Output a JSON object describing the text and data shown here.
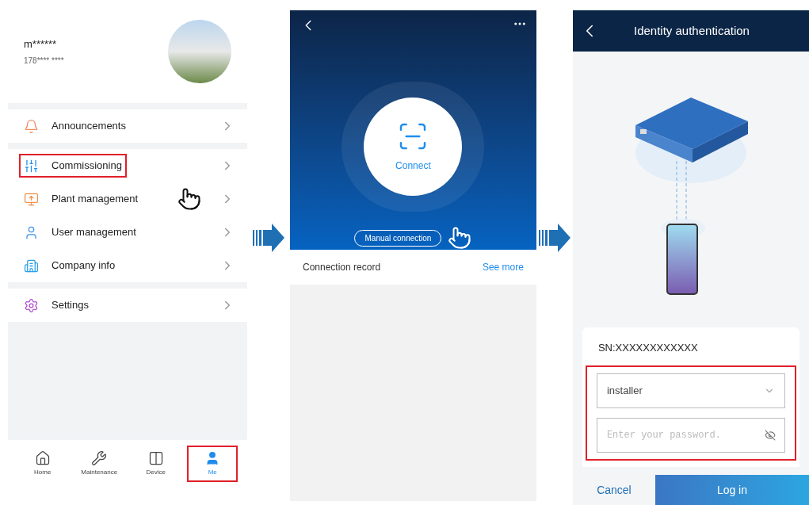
{
  "profile": {
    "name": "m******",
    "phone": "178**** ****"
  },
  "menu_groups": [
    [
      {
        "label": "Announcements",
        "highlighted": false
      }
    ],
    [
      {
        "label": "Commissioning",
        "highlighted": true
      },
      {
        "label": "Plant management",
        "highlighted": false
      },
      {
        "label": "User management",
        "highlighted": false
      },
      {
        "label": "Company info",
        "highlighted": false
      }
    ],
    [
      {
        "label": "Settings",
        "highlighted": false
      }
    ]
  ],
  "tab_bar": [
    {
      "label": "Home",
      "selected": false,
      "highlighted": false
    },
    {
      "label": "Maintenance",
      "selected": false,
      "highlighted": false
    },
    {
      "label": "Device",
      "selected": false,
      "highlighted": false
    },
    {
      "label": "Me",
      "selected": true,
      "highlighted": true
    }
  ],
  "connect_screen": {
    "connect_label": "Connect",
    "manual_button": "Manual connection",
    "record_title": "Connection record",
    "see_more": "See more"
  },
  "auth_screen": {
    "title": "Identity authentication",
    "sn": "SN:XXXXXXXXXXXX",
    "user_field": {
      "value": "installer"
    },
    "password_field": {
      "placeholder": "Enter your password."
    },
    "fields_highlighted": true,
    "cancel": "Cancel",
    "login": "Log in"
  }
}
